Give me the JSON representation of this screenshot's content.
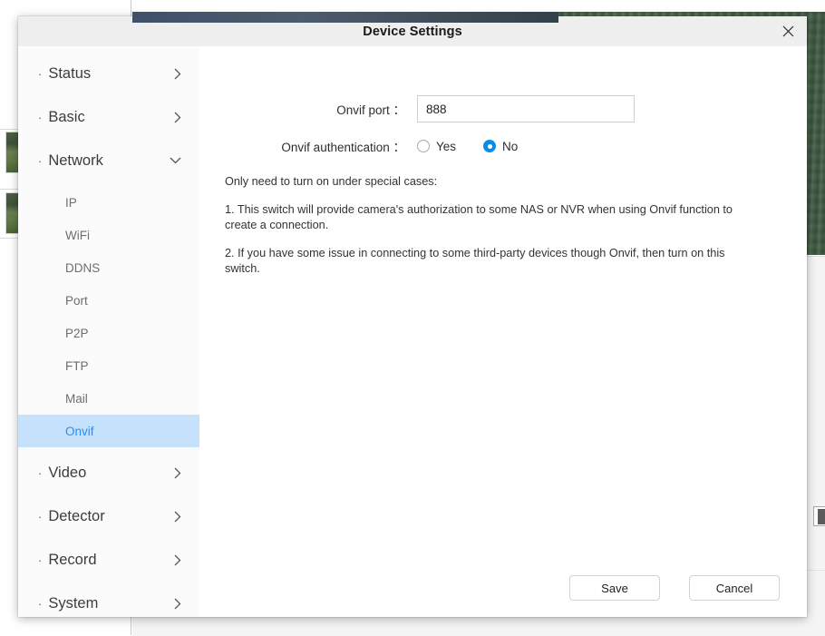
{
  "background": {
    "panel_handle": "collapse-handle"
  },
  "dialog": {
    "title": "Device Settings",
    "close_label": "×"
  },
  "sidebar": {
    "groups_top": [
      {
        "label": "Status",
        "chevron": "chevron-right"
      },
      {
        "label": "Basic",
        "chevron": "chevron-right"
      },
      {
        "label": "Network",
        "chevron": "chevron-down"
      }
    ],
    "network_items": [
      {
        "label": "IP",
        "active": false
      },
      {
        "label": "WiFi",
        "active": false
      },
      {
        "label": "DDNS",
        "active": false
      },
      {
        "label": "Port",
        "active": false
      },
      {
        "label": "P2P",
        "active": false
      },
      {
        "label": "FTP",
        "active": false
      },
      {
        "label": "Mail",
        "active": false
      },
      {
        "label": "Onvif",
        "active": true
      }
    ],
    "groups_bottom": [
      {
        "label": "Video",
        "chevron": "chevron-right"
      },
      {
        "label": "Detector",
        "chevron": "chevron-right"
      },
      {
        "label": "Record",
        "chevron": "chevron-right"
      },
      {
        "label": "System",
        "chevron": "chevron-right"
      }
    ],
    "bullet": "·",
    "active_bg": "#c6e1fb",
    "active_color": "#2a8df2"
  },
  "form": {
    "onvif_port": {
      "label": "Onvif port ：",
      "value": "888",
      "placeholder": ""
    },
    "onvif_authentication": {
      "label": "Onvif authentication ：",
      "options": [
        {
          "label": "Yes",
          "selected": false
        },
        {
          "label": "No",
          "selected": true
        }
      ],
      "selected_value": "No"
    }
  },
  "notes": [
    "Only need to turn on under special cases:",
    "1. This switch will provide camera's authorization to some NAS or NVR when using Onvif function to create a connection.",
    "2. If you have some issue in connecting to some third-party devices though Onvif, then turn on this switch."
  ],
  "footer": {
    "save_label": "Save",
    "cancel_label": "Cancel"
  }
}
